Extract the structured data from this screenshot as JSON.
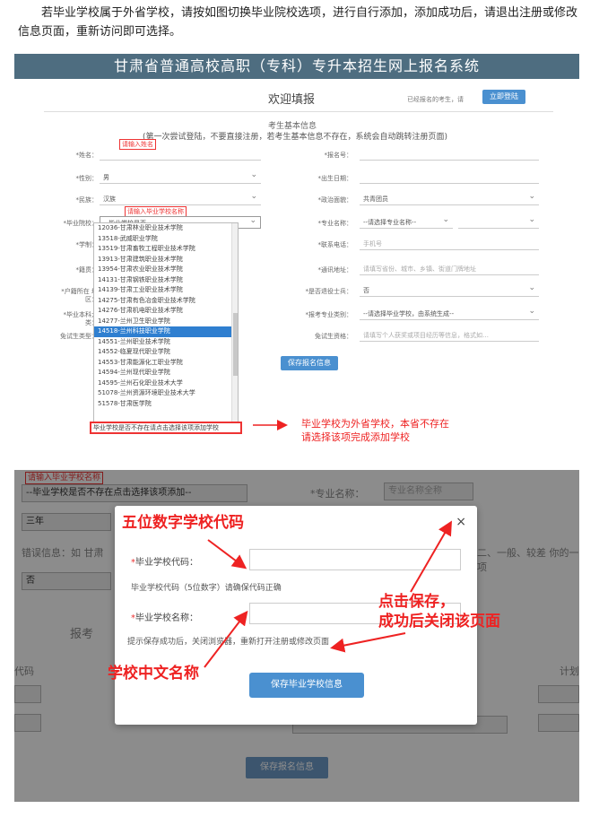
{
  "intro": "若毕业学校属于外省学校，请按如图切换毕业院校选项，进行自行添加，添加成功后，请退出注册或修改信息页面，重新访问即可选择。",
  "screenshot1": {
    "banner": "甘肃省普通高校高职（专科）专升本招生网上报名系统",
    "welcome": "欢迎填报",
    "header_status": "已经报名的考生，请",
    "header_button": "立即登陆",
    "section_title": "考生基本信息",
    "hint": "(第一次尝试登陆，不要直接注册，若考生基本信息不存在，系统会自动跳转注册页面)",
    "tag_name": "请输入姓名",
    "tag_school": "请输入毕业学校名称",
    "left_labels": [
      "*姓名：",
      "*性别：",
      "*民族：",
      "*毕业院校：",
      "*学制：",
      "*籍贯：",
      "*户籍所在\n地区：",
      "*毕业本科大\n类：",
      "免试生类型："
    ],
    "right_labels": [
      "*报名号：",
      "*出生日期：",
      "*政治面貌：",
      "*专业名称：",
      "*联系电话：",
      "*通讯地址：",
      "*是否退役士兵：",
      "*报考专业类别：",
      "免试生资格："
    ],
    "left_values": [
      "",
      "男",
      "汉族",
      "--毕业学校是否…",
      ""
    ],
    "right_values": [
      "",
      "",
      "共青团员",
      "--请选择专业名称--",
      "手机号",
      "请填写省份、城市、乡镇、街道门牌地址",
      "否",
      "--请选择毕业学校，由系统生成--",
      "请填写个人获奖或项目经历等信息，格式如…"
    ],
    "dropdown_items": [
      "12036-甘肃林业职业技术学院",
      "13518-武威职业学院",
      "13519-甘肃畜牧工程职业技术学院",
      "13913-甘肃建筑职业技术学院",
      "13954-甘肃农业职业技术学院",
      "14131-甘肃钢铁职业技术学院",
      "14139-甘肃工业职业技术学院",
      "14275-甘肃有色冶金职业技术学院",
      "14276-甘肃机电职业技术学院",
      "14277-兰州卫生职业学院",
      "14518-兰州科技职业学院",
      "14551-兰州职业技术学院",
      "14552-临夏现代职业学院",
      "14553-甘肃能源化工职业学院",
      "14594-兰州现代职业学院",
      "14595-兰州石化职业技术大学",
      "51078-兰州资源环境职业技术大学",
      "51578-甘肃医学院"
    ],
    "dropdown_selected_index": 10,
    "dropdown_last": "毕业学校是否不存在请点击选择该项添加学校",
    "save_button": "保存报名信息",
    "annotation": "毕业学校为外省学校，本省不存在\n请选择该项完成添加学校"
  },
  "screenshot2": {
    "bg_tag": "请输入毕业学校名称",
    "bg_select": "--毕业学校是否不存在点击选择该项添加--",
    "bg_major_label": "*专业名称：",
    "bg_major_placeholder": "专业名称全称",
    "bg_year": "三年",
    "bg_error": "错误信息：如 甘肃",
    "bg_error_right": "二、一般、较差 你的一项",
    "bg_no": "否",
    "bg_report": "报考",
    "bg_code": "代码",
    "bg_plan": "计划",
    "modal_code_label": "毕业学校代码：",
    "modal_code_hint": "毕业学校代码（5位数字）请确保代码正确",
    "modal_name_label": "毕业学校名称：",
    "modal_name_hint": "提示保存成功后，关闭浏览器，重新打开注册或修改页面",
    "modal_button": "保存毕业学校信息",
    "close": "×",
    "annot_code": "五位数字学校代码",
    "annot_name": "学校中文名称",
    "annot_save": "点击保存，\n成功后关闭该页面",
    "save_button": "保存报名信息"
  },
  "colors": {
    "banner": "#4e6d80",
    "accent": "#4a90d0",
    "annotation": "#e22222"
  }
}
